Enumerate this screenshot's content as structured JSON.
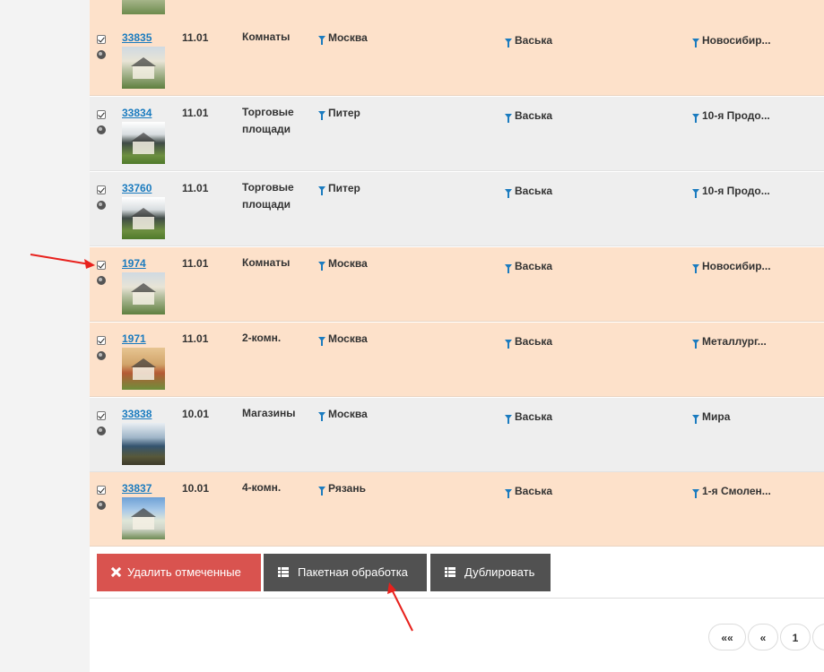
{
  "rows": [
    {
      "id": "33835",
      "date": "11.01",
      "type": "Комнаты",
      "city": "Москва",
      "agent": "Васька",
      "street": "Новосибир..."
    },
    {
      "id": "33834",
      "date": "11.01",
      "type": "Торговые площади",
      "city": "Питер",
      "agent": "Васька",
      "street": "10-я Продо..."
    },
    {
      "id": "33760",
      "date": "11.01",
      "type": "Торговые площади",
      "city": "Питер",
      "agent": "Васька",
      "street": "10-я Продо..."
    },
    {
      "id": "1974",
      "date": "11.01",
      "type": "Комнаты",
      "city": "Москва",
      "agent": "Васька",
      "street": "Новосибир..."
    },
    {
      "id": "1971",
      "date": "11.01",
      "type": "2-комн.",
      "city": "Москва",
      "agent": "Васька",
      "street": "Металлург..."
    },
    {
      "id": "33838",
      "date": "10.01",
      "type": "Магазины",
      "city": "Москва",
      "agent": "Васька",
      "street": "Мира"
    },
    {
      "id": "33837",
      "date": "10.01",
      "type": "4-комн.",
      "city": "Рязань",
      "agent": "Васька",
      "street": "1-я Смолен..."
    }
  ],
  "actions": {
    "delete_label": "Удалить отмеченные",
    "batch_label": "Пакетная обработка",
    "duplicate_label": "Дублировать"
  },
  "pagination": {
    "first": "««",
    "prev": "«",
    "page": "1"
  },
  "colors": {
    "row_highlight": "#fde1ca",
    "row_default": "#eeeeee",
    "link": "#1a7bbf",
    "danger": "#d9534f",
    "dark_button": "#515151",
    "annotation_arrow": "#e8211d"
  }
}
